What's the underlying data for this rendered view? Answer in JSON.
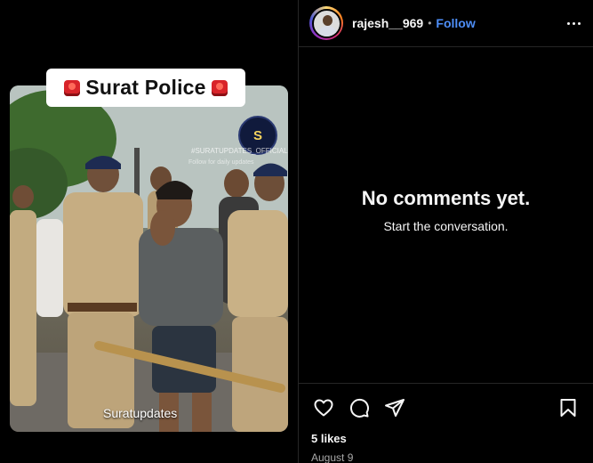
{
  "media": {
    "overlay_title": "Surat Police",
    "logo_text": "S",
    "watermark_handle": "#SURATUPDATES_OFFICIAL",
    "watermark_sub": "Follow for daily updates",
    "caption": "Suratupdates"
  },
  "post": {
    "username": "rajesh__969",
    "separator": "•",
    "follow_label": "Follow"
  },
  "comments": {
    "empty_title": "No comments yet.",
    "empty_subtitle": "Start the conversation."
  },
  "footer": {
    "likes": "5 likes",
    "date": "August 9"
  },
  "colors": {
    "accent": "#4e8ef7",
    "background": "#000000",
    "border": "#262626",
    "secondary_text": "#a8a8a8"
  },
  "icons": [
    "heart-icon",
    "comment-icon",
    "share-icon",
    "bookmark-icon",
    "more-icon"
  ]
}
